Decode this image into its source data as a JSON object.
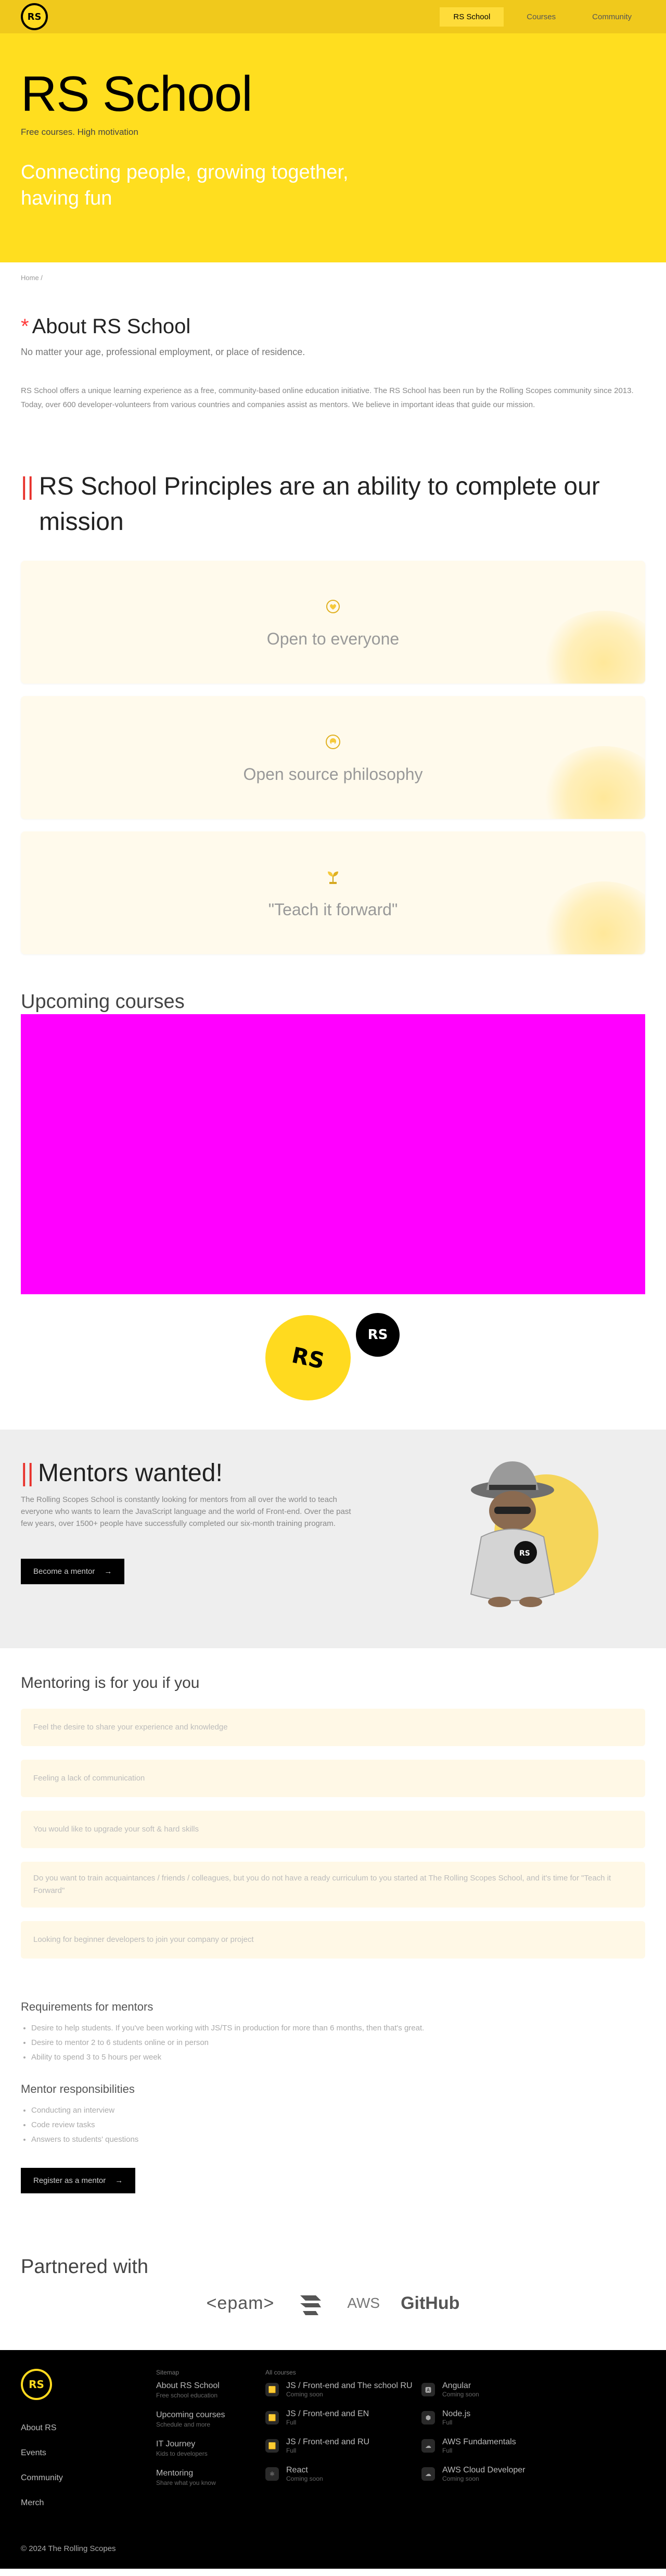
{
  "header": {
    "logo": "RS",
    "nav": [
      "RS School",
      "Courses",
      "Community"
    ]
  },
  "hero": {
    "title": "RS School",
    "subtitle": "Free courses. High motivation",
    "slogan": "Connecting people, growing together, having fun"
  },
  "breadcrumb": "Home /",
  "about": {
    "title": "About RS School",
    "intro": "No matter your age, professional employment, or place of residence.",
    "description": "RS School offers a unique learning experience as a free, community-based online education initiative. The RS School has been run by the Rolling Scopes community since 2013. Today, over 600 developer-volunteers from various countries and companies assist as mentors. We believe in important ideas that guide our mission."
  },
  "principles": {
    "title": "RS School Principles are an ability to complete our mission",
    "items": [
      {
        "label": "Open to everyone",
        "icon": "heart-hand-icon"
      },
      {
        "label": "Open source philosophy",
        "icon": "open-source-icon"
      },
      {
        "label": "\"Teach it forward\"",
        "icon": "plant-icon"
      }
    ]
  },
  "upcoming": {
    "title": "Upcoming courses",
    "big_logo": "RS",
    "small_logo": "RS"
  },
  "mentors": {
    "title": "Mentors wanted!",
    "text": "The Rolling Scopes School is constantly looking for mentors from all over the world to teach everyone who wants to learn the JavaScript language and the world of Front-end. Over the past few years, over 1500+ people have successfully completed our six-month training program.",
    "button": "Become a mentor",
    "mascot_badge": "RS"
  },
  "for_you": {
    "title": "Mentoring is for you if you",
    "items": [
      "Feel the desire to share your experience and knowledge",
      "Feeling a lack of communication",
      "You would like to upgrade your soft & hard skills",
      "Do you want to train acquaintances / friends / colleagues, but you do not have a ready curriculum to you started at The Rolling Scopes School, and it's time for \"Teach it Forward\"",
      "Looking for beginner developers to join your company or project"
    ]
  },
  "requirements": {
    "title": "Requirements for mentors",
    "items": [
      "Desire to help students. If you've been working with JS/TS in production for more than 6 months, then that's great.",
      "Desire to mentor 2 to 6 students online or in person",
      "Ability to spend 3 to 5 hours per week"
    ]
  },
  "responsibilities": {
    "title": "Mentor responsibilities",
    "items": [
      "Conducting an interview",
      "Code review tasks",
      "Answers to students' questions"
    ],
    "button": "Register as a mentor"
  },
  "partners": {
    "title": "Partnered with",
    "logos": [
      "<epam>",
      "AWS",
      "GitHub"
    ]
  },
  "footer": {
    "logo": "RS",
    "links": [
      "About RS",
      "Events",
      "Community",
      "Merch"
    ],
    "col2_head": "Sitemap",
    "col2": [
      {
        "title": "About RS School",
        "sub": "Free school education"
      },
      {
        "title": "Upcoming courses",
        "sub": "Schedule and more"
      },
      {
        "title": "IT Journey",
        "sub": "Kids to developers"
      },
      {
        "title": "Mentoring",
        "sub": "Share what you know"
      }
    ],
    "courses_head": "All courses",
    "courses": [
      {
        "title": "JS / Front-end and The school RU",
        "sub": "Coming soon"
      },
      {
        "title": "Angular",
        "sub": "Coming soon"
      },
      {
        "title": "JS / Front-end and EN",
        "sub": "Full"
      },
      {
        "title": "Node.js",
        "sub": "Full"
      },
      {
        "title": "JS / Front-end and RU",
        "sub": "Full"
      },
      {
        "title": "AWS Fundamentals",
        "sub": "Full"
      },
      {
        "title": "React",
        "sub": "Coming soon"
      },
      {
        "title": "AWS Cloud Developer",
        "sub": "Coming soon"
      }
    ],
    "copyright": "© 2024 The Rolling Scopes"
  }
}
